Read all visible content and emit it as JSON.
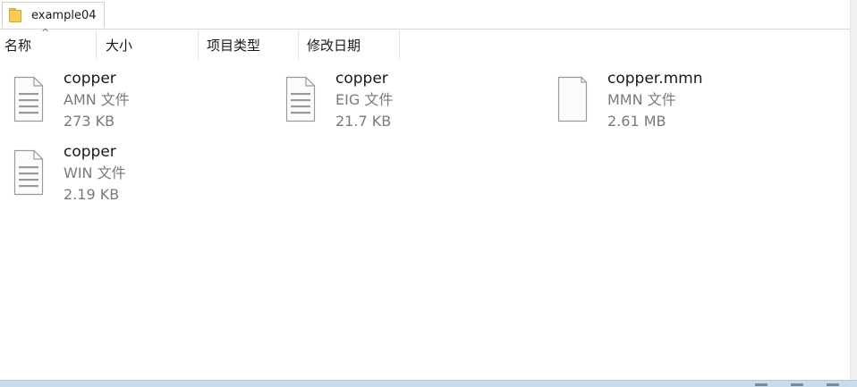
{
  "breadcrumb": {
    "folder": "example04",
    "icon": "folder-icon"
  },
  "columns": {
    "name": "名称",
    "size": "大小",
    "type": "项目类型",
    "modified": "修改日期",
    "sort_indicator": "^"
  },
  "files": [
    {
      "name": "copper",
      "type": "AMN 文件",
      "size": "273 KB",
      "icon": "document-icon",
      "blank": false
    },
    {
      "name": "copper",
      "type": "EIG 文件",
      "size": "21.7 KB",
      "icon": "document-icon",
      "blank": false
    },
    {
      "name": "copper.mmn",
      "type": "MMN 文件",
      "size": "2.61 MB",
      "icon": "blank-document-icon",
      "blank": true
    },
    {
      "name": "copper",
      "type": "WIN 文件",
      "size": "2.19 KB",
      "icon": "document-icon",
      "blank": false
    }
  ],
  "colors": {
    "header_border": "#d9d9d9",
    "meta_text": "#7a7a7a",
    "folder": "#f7cd5a",
    "bottom_bar": "#c9dcec"
  }
}
